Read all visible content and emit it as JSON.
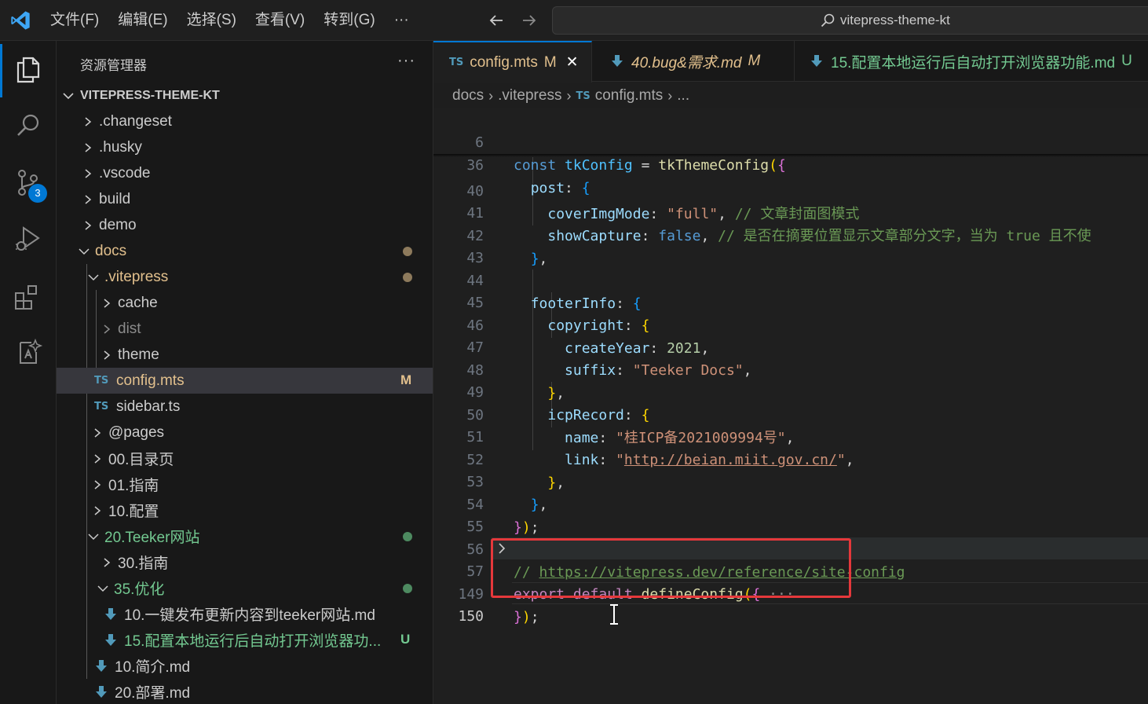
{
  "menu": {
    "items": [
      "文件(F)",
      "编辑(E)",
      "选择(S)",
      "查看(V)",
      "转到(G)"
    ],
    "more": "···"
  },
  "search": {
    "text": "vitepress-theme-kt"
  },
  "activity": {
    "scm_badge": "3",
    "accent": "#0078d4"
  },
  "sidebar": {
    "title": "资源管理器",
    "more": "···",
    "section": "VITEPRESS-THEME-KT",
    "rows": [
      {
        "label": ".changeset"
      },
      {
        "label": ".husky"
      },
      {
        "label": ".vscode"
      },
      {
        "label": "build"
      },
      {
        "label": "demo"
      },
      {
        "label": "docs"
      },
      {
        "label": ".vitepress"
      },
      {
        "label": "cache"
      },
      {
        "label": "dist"
      },
      {
        "label": "theme"
      },
      {
        "label": "config.mts",
        "icon": "TS",
        "status": "M"
      },
      {
        "label": "sidebar.ts",
        "icon": "TS"
      },
      {
        "label": "@pages"
      },
      {
        "label": "00.目录页"
      },
      {
        "label": "01.指南"
      },
      {
        "label": "10.配置"
      },
      {
        "label": "20.Teeker网站"
      },
      {
        "label": "30.指南"
      },
      {
        "label": "35.优化"
      },
      {
        "label": "10.一键发布更新内容到teeker网站.md"
      },
      {
        "label": "15.配置本地运行后自动打开浏览器功...",
        "status": "U"
      },
      {
        "label": "10.简介.md"
      },
      {
        "label": "20.部署.md"
      }
    ]
  },
  "tabs": [
    {
      "icon": "TS",
      "label": "config.mts",
      "state": "M",
      "close": "✕"
    },
    {
      "label": "40.bug&需求.md",
      "state": "M"
    },
    {
      "label": "15.配置本地运行后自动打开浏览器功能.md",
      "state": "U"
    }
  ],
  "breadcrumbs": [
    "docs",
    ".vitepress",
    "TS",
    "config.mts",
    "..."
  ],
  "editor": {
    "line_numbers": [
      "6",
      "36",
      "40",
      "41",
      "42",
      "43",
      "44",
      "45",
      "46",
      "47",
      "48",
      "49",
      "50",
      "51",
      "52",
      "53",
      "54",
      "55",
      "56",
      "57",
      "149",
      "150"
    ],
    "tokens": {
      "l6": [
        "const",
        "tkConfig",
        "=",
        "tkThemeConfig",
        "(",
        "{"
      ],
      "l36": [
        "post",
        ":",
        "{"
      ],
      "l40": [
        "coverImgMode",
        ":",
        "\"full\"",
        ",",
        "// 文章封面图模式"
      ],
      "l41": [
        "showCapture",
        ":",
        "false",
        ",",
        "// 是否在摘要位置显示文章部分文字，当为 true 且不使"
      ],
      "l42": [
        "}",
        ","
      ],
      "l44": [
        "footerInfo",
        ":",
        "{"
      ],
      "l45": [
        "copyright",
        ":",
        "{"
      ],
      "l46": [
        "createYear",
        ":",
        "2021",
        ","
      ],
      "l47": [
        "suffix",
        ":",
        "\"Teeker Docs\"",
        ","
      ],
      "l48": [
        "}",
        ","
      ],
      "l49": [
        "icpRecord",
        ":",
        "{"
      ],
      "l50": [
        "name",
        ":",
        "\"桂ICP备2021009994号\"",
        ","
      ],
      "l51": [
        "link",
        ":",
        "\"",
        "http://beian.miit.gov.cn/",
        "\"",
        ","
      ],
      "l52": [
        "}",
        ","
      ],
      "l53": [
        "}",
        ","
      ],
      "l54": [
        "}",
        ")",
        ";"
      ],
      "l56_a": "// ",
      "l56_b": "https://vitepress.dev/reference/site-config",
      "l57": [
        "export",
        "default",
        "defineConfig",
        "(",
        "{",
        "···"
      ],
      "l149": [
        "}",
        ")",
        ";"
      ]
    }
  }
}
